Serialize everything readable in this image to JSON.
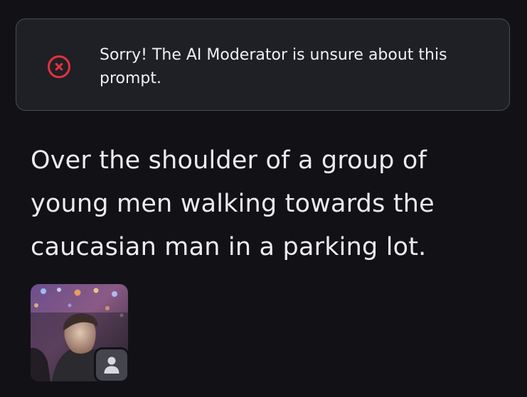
{
  "alert": {
    "icon": "error-circle-x-icon",
    "color": "#e5323b",
    "message": "Sorry! The AI Moderator is unsure about this prompt."
  },
  "prompt": {
    "text": "Over the shoulder of a group of young men walking towards the caucasian man in a parking lot."
  },
  "thumbnail": {
    "badge_icon": "user-icon"
  }
}
